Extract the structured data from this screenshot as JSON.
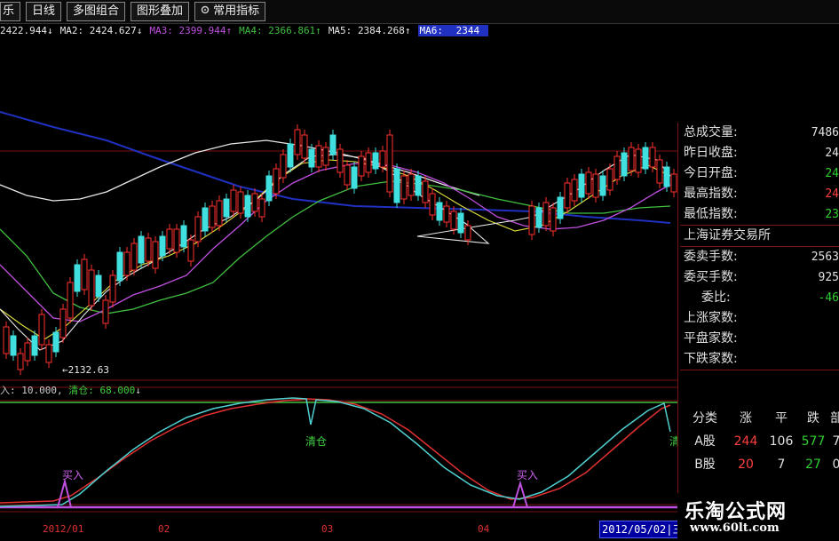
{
  "toolbar": {
    "items": [
      "乐",
      "日线",
      "多图组合",
      "图形叠加",
      "常用指标"
    ]
  },
  "ma_row": {
    "ma1": "2422.944↓",
    "ma2_label": "MA2:",
    "ma2": "2424.627↓",
    "ma3_label": "MA3:",
    "ma3": "2399.944↑",
    "ma4_label": "MA4:",
    "ma4": "2366.861↑",
    "ma5_label": "MA5:",
    "ma5": "2384.268↑",
    "ma6_label": "MA6:",
    "ma6": "2344"
  },
  "low_label": "←2132.63",
  "indicator_row": {
    "part1": "入: 10.000,",
    "part2": "清仓: 68.000",
    "arrow": "↓"
  },
  "signals": {
    "buy1": "买入",
    "sell1": "清仓",
    "buy2": "买入",
    "sell2": "清"
  },
  "axis": [
    "2012/01",
    "02",
    "03",
    "04"
  ],
  "date_box": "2012/05/02|三",
  "info": {
    "rows": [
      {
        "k": "总成交量:",
        "v": "7486"
      },
      {
        "k": "昨日收盘:",
        "v": "24"
      },
      {
        "k": "今日开盘:",
        "v": "24"
      },
      {
        "k": "最高指数:",
        "v": "24"
      },
      {
        "k": "最低指数:",
        "v": "23"
      }
    ],
    "exchange": "上海证券交易所",
    "rows2": [
      {
        "k": "委卖手数:",
        "v": "2563"
      },
      {
        "k": "委买手数:",
        "v": "925"
      },
      {
        "k": "委比:",
        "v": "-46"
      },
      {
        "k": "上涨家数:",
        "v": ""
      },
      {
        "k": "平盘家数:",
        "v": ""
      },
      {
        "k": "下跌家数:",
        "v": ""
      }
    ]
  },
  "table": {
    "headers": [
      "分类",
      "涨",
      "平",
      "跌",
      "部"
    ],
    "rows": [
      {
        "name": "A股",
        "up": "244",
        "flat": "106",
        "down": "577",
        "more": "7"
      },
      {
        "name": "B股",
        "up": "20",
        "flat": "7",
        "down": "27",
        "more": "0"
      }
    ]
  },
  "watermark": {
    "title": "乐淘公式网",
    "url": "www.60lt.com"
  },
  "colors": {
    "up": "#ff3030",
    "down": "#40e0e0",
    "ma_white": "#e8e8e8",
    "ma_yellow": "#e0e040",
    "ma_magenta": "#c050e0",
    "ma_green": "#40c040",
    "ma_blue": "#2030c0",
    "grid": "#7a1010"
  }
}
